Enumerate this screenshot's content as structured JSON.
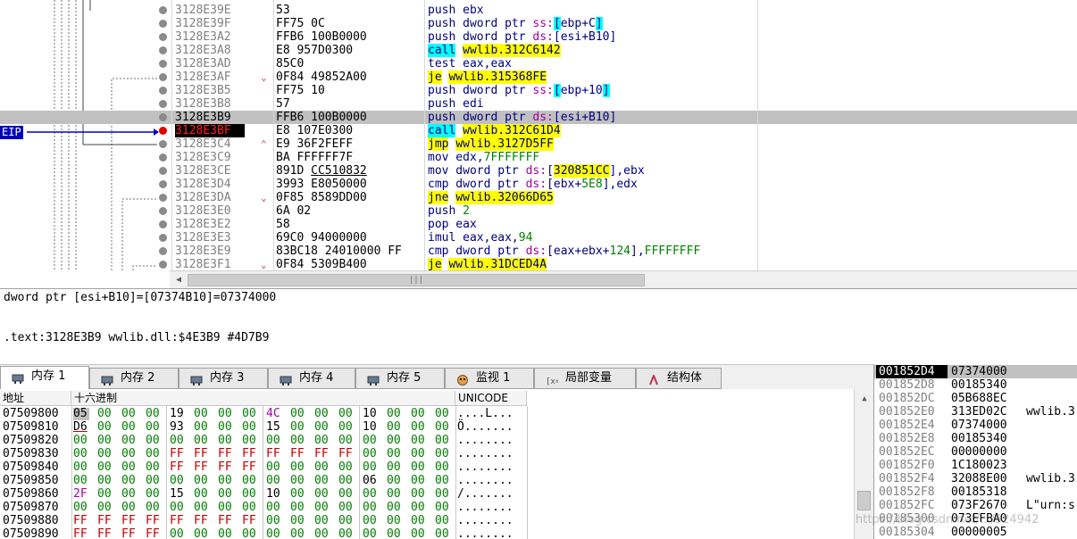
{
  "disasm": {
    "eip_label": "EIP",
    "rows": [
      {
        "addr": "3128E39E",
        "bytes": "53",
        "mark": "",
        "instr": [
          {
            "t": "push ebx"
          }
        ]
      },
      {
        "addr": "3128E39F",
        "bytes": "FF75 0C",
        "mark": "",
        "instr": [
          {
            "t": "push dword ptr "
          },
          {
            "t": "ss:",
            "c": "seg"
          },
          {
            "t": "[",
            "c": "hl-c"
          },
          {
            "t": "ebp+C"
          },
          {
            "t": "]",
            "c": "hl-c"
          }
        ]
      },
      {
        "addr": "3128E3A2",
        "bytes": "FFB6 100B0000",
        "mark": "",
        "instr": [
          {
            "t": "push dword ptr "
          },
          {
            "t": "ds:",
            "c": "seg"
          },
          {
            "t": "[esi+B10]"
          }
        ]
      },
      {
        "addr": "3128E3A8",
        "bytes": "E8 957D0300",
        "mark": "",
        "instr": [
          {
            "t": "call",
            "c": "hl-c"
          },
          {
            "t": " "
          },
          {
            "t": "wwlib.312C6142",
            "c": "hl-y"
          }
        ]
      },
      {
        "addr": "3128E3AD",
        "bytes": "85C0",
        "mark": "",
        "instr": [
          {
            "t": "test eax,eax"
          }
        ]
      },
      {
        "addr": "3128E3AF",
        "bytes": "0F84 49852A00",
        "mark": "v",
        "instr": [
          {
            "t": "je",
            "c": "hl-y"
          },
          {
            "t": " "
          },
          {
            "t": "wwlib.315368FE",
            "c": "hl-y"
          }
        ]
      },
      {
        "addr": "3128E3B5",
        "bytes": "FF75 10",
        "mark": "",
        "instr": [
          {
            "t": "push dword ptr "
          },
          {
            "t": "ss:",
            "c": "seg"
          },
          {
            "t": "[",
            "c": "hl-c"
          },
          {
            "t": "ebp+10"
          },
          {
            "t": "]",
            "c": "hl-c"
          }
        ]
      },
      {
        "addr": "3128E3B8",
        "bytes": "57",
        "mark": "",
        "instr": [
          {
            "t": "push edi"
          }
        ]
      },
      {
        "addr": "3128E3B9",
        "bytes": "FFB6 100B0000",
        "mark": "",
        "sel": true,
        "instr": [
          {
            "t": "push dword ptr "
          },
          {
            "t": "ds:",
            "c": "seg"
          },
          {
            "t": "[esi+B10]"
          }
        ]
      },
      {
        "addr": "3128E3BF",
        "bytes": "E8 107E0300",
        "mark": "",
        "cur": true,
        "instr": [
          {
            "t": "call",
            "c": "hl-c"
          },
          {
            "t": " "
          },
          {
            "t": "wwlib.312C61D4",
            "c": "hl-y"
          }
        ]
      },
      {
        "addr": "3128E3C4",
        "bytes": "E9 36F2FEFF",
        "mark": "^",
        "instr": [
          {
            "t": "jmp",
            "c": "hl-y"
          },
          {
            "t": " "
          },
          {
            "t": "wwlib.3127D5FF",
            "c": "hl-y"
          }
        ]
      },
      {
        "addr": "3128E3C9",
        "bytes": "BA FFFFFF7F",
        "mark": "",
        "instr": [
          {
            "t": "mov edx,"
          },
          {
            "t": "7FFFFFFF",
            "c": "num"
          }
        ]
      },
      {
        "addr": "3128E3CE",
        "bytes": "891D CC510832",
        "mark": "",
        "ul": true,
        "instr": [
          {
            "t": "mov dword ptr "
          },
          {
            "t": "ds:",
            "c": "seg"
          },
          {
            "t": "["
          },
          {
            "t": "320851CC",
            "c": "hl-y"
          },
          {
            "t": "],ebx"
          }
        ]
      },
      {
        "addr": "3128E3D4",
        "bytes": "3993 E8050000",
        "mark": "",
        "instr": [
          {
            "t": "cmp dword ptr "
          },
          {
            "t": "ds:",
            "c": "seg"
          },
          {
            "t": "[ebx+"
          },
          {
            "t": "5E8",
            "c": "num"
          },
          {
            "t": "],edx"
          }
        ]
      },
      {
        "addr": "3128E3DA",
        "bytes": "0F85 8589DD00",
        "mark": "v",
        "instr": [
          {
            "t": "jne",
            "c": "hl-y"
          },
          {
            "t": " "
          },
          {
            "t": "wwlib.32066D65",
            "c": "hl-y"
          }
        ]
      },
      {
        "addr": "3128E3E0",
        "bytes": "6A 02",
        "mark": "",
        "instr": [
          {
            "t": "push "
          },
          {
            "t": "2",
            "c": "num"
          }
        ]
      },
      {
        "addr": "3128E3E2",
        "bytes": "58",
        "mark": "",
        "instr": [
          {
            "t": "pop eax"
          }
        ]
      },
      {
        "addr": "3128E3E3",
        "bytes": "69C0 94000000",
        "mark": "",
        "instr": [
          {
            "t": "imul eax,eax,"
          },
          {
            "t": "94",
            "c": "num"
          }
        ]
      },
      {
        "addr": "3128E3E9",
        "bytes": "83BC18 24010000 FF",
        "mark": "",
        "instr": [
          {
            "t": "cmp dword ptr "
          },
          {
            "t": "ds:",
            "c": "seg"
          },
          {
            "t": "[eax+ebx+"
          },
          {
            "t": "124",
            "c": "num"
          },
          {
            "t": "],"
          },
          {
            "t": "FFFFFFFF",
            "c": "num"
          }
        ]
      },
      {
        "addr": "3128E3F1",
        "bytes": "0F84 5309B400",
        "mark": "v",
        "instr": [
          {
            "t": "je",
            "c": "hl-y"
          },
          {
            "t": " "
          },
          {
            "t": "wwlib.31DCED4A",
            "c": "hl-y"
          }
        ]
      }
    ]
  },
  "info": {
    "line1": "dword ptr [esi+B10]=[07374B10]=07374000",
    "line2": ".text:3128E3B9 wwlib.dll:$4E3B9 #4D7B9"
  },
  "tabs": [
    {
      "label": "内存 1",
      "icon": "memory-icon",
      "active": true
    },
    {
      "label": "内存 2",
      "icon": "memory-icon"
    },
    {
      "label": "内存 3",
      "icon": "memory-icon"
    },
    {
      "label": "内存 4",
      "icon": "memory-icon"
    },
    {
      "label": "内存 5",
      "icon": "memory-icon"
    },
    {
      "label": "监视 1",
      "icon": "watch-icon"
    },
    {
      "label": "局部变量",
      "icon": "variable-icon"
    },
    {
      "label": "结构体",
      "icon": "struct-icon"
    }
  ],
  "dump": {
    "headers": {
      "addr": "地址",
      "hex": "十六进制",
      "unicode": "UNICODE"
    },
    "rows": [
      {
        "addr": "07509800",
        "bytes": [
          "05",
          "00",
          "00",
          "00",
          "19",
          "00",
          "00",
          "00",
          "4C",
          "00",
          "00",
          "00",
          "10",
          "00",
          "00",
          "00"
        ],
        "ascii": "....L..."
      },
      {
        "addr": "07509810",
        "bytes": [
          "D6",
          "00",
          "00",
          "00",
          "93",
          "00",
          "00",
          "00",
          "15",
          "00",
          "00",
          "00",
          "10",
          "00",
          "00",
          "00"
        ],
        "ascii": "Ö......."
      },
      {
        "addr": "07509820",
        "bytes": [
          "00",
          "00",
          "00",
          "00",
          "00",
          "00",
          "00",
          "00",
          "00",
          "00",
          "00",
          "00",
          "00",
          "00",
          "00",
          "00"
        ],
        "ascii": "........"
      },
      {
        "addr": "07509830",
        "bytes": [
          "00",
          "00",
          "00",
          "00",
          "FF",
          "FF",
          "FF",
          "FF",
          "FF",
          "FF",
          "FF",
          "FF",
          "00",
          "00",
          "00",
          "00"
        ],
        "ascii": "........"
      },
      {
        "addr": "07509840",
        "bytes": [
          "00",
          "00",
          "00",
          "00",
          "FF",
          "FF",
          "FF",
          "FF",
          "00",
          "00",
          "00",
          "00",
          "00",
          "00",
          "00",
          "00"
        ],
        "ascii": "........"
      },
      {
        "addr": "07509850",
        "bytes": [
          "00",
          "00",
          "00",
          "00",
          "00",
          "00",
          "00",
          "00",
          "00",
          "00",
          "00",
          "00",
          "06",
          "00",
          "00",
          "00"
        ],
        "ascii": "........"
      },
      {
        "addr": "07509860",
        "bytes": [
          "2F",
          "00",
          "00",
          "00",
          "15",
          "00",
          "00",
          "00",
          "10",
          "00",
          "00",
          "00",
          "00",
          "00",
          "00",
          "00"
        ],
        "ascii": "/......."
      },
      {
        "addr": "07509870",
        "bytes": [
          "00",
          "00",
          "00",
          "00",
          "00",
          "00",
          "00",
          "00",
          "00",
          "00",
          "00",
          "00",
          "00",
          "00",
          "00",
          "00"
        ],
        "ascii": "........"
      },
      {
        "addr": "07509880",
        "bytes": [
          "FF",
          "FF",
          "FF",
          "FF",
          "FF",
          "FF",
          "FF",
          "FF",
          "00",
          "00",
          "00",
          "00",
          "00",
          "00",
          "00",
          "00"
        ],
        "ascii": "........"
      },
      {
        "addr": "07509890",
        "bytes": [
          "FF",
          "FF",
          "FF",
          "FF",
          "00",
          "00",
          "00",
          "00",
          "00",
          "00",
          "00",
          "00",
          "00",
          "00",
          "00",
          "00"
        ],
        "ascii": "........"
      }
    ]
  },
  "stack": {
    "rows": [
      {
        "addr": "001852D4",
        "val": "07374000",
        "com": ""
      },
      {
        "addr": "001852D8",
        "val": "00185340",
        "com": ""
      },
      {
        "addr": "001852DC",
        "val": "05B688EC",
        "com": ""
      },
      {
        "addr": "001852E0",
        "val": "313ED02C",
        "com": "wwlib.3"
      },
      {
        "addr": "001852E4",
        "val": "07374000",
        "com": ""
      },
      {
        "addr": "001852E8",
        "val": "00185340",
        "com": ""
      },
      {
        "addr": "001852EC",
        "val": "00000000",
        "com": ""
      },
      {
        "addr": "001852F0",
        "val": "1C180023",
        "com": ""
      },
      {
        "addr": "001852F4",
        "val": "32088E00",
        "com": "wwlib.3"
      },
      {
        "addr": "001852F8",
        "val": "00185318",
        "com": ""
      },
      {
        "addr": "001852FC",
        "val": "073F2670",
        "com": "L\"urn:s"
      },
      {
        "addr": "00185300",
        "val": "073EFBA0",
        "com": ""
      },
      {
        "addr": "00185304",
        "val": "00000005",
        "com": ""
      }
    ]
  },
  "watermark": "https://blog.csdn.net/.../924942",
  "colors": {
    "highlight_yellow": "#ffff00",
    "highlight_cyan": "#00ffff",
    "eip": "#0000c0",
    "breakpoint": "#e00000"
  }
}
